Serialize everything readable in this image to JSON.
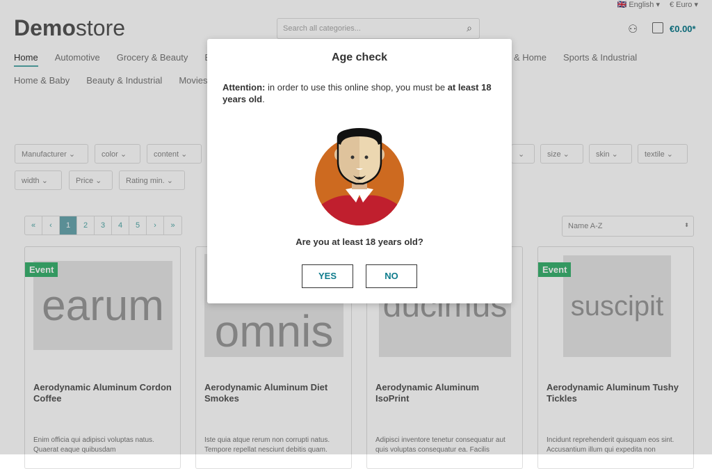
{
  "header": {
    "language": "English",
    "currency": "€ Euro",
    "logo_bold": "Demo",
    "logo_light": "store",
    "search_placeholder": "Search all categories...",
    "cart_total": "€0.00*"
  },
  "nav": {
    "row1": [
      "Home",
      "Automotive",
      "Grocery & Beauty",
      "Be",
      "& Home",
      "Sports & Industrial"
    ],
    "row2": [
      "Home & Baby",
      "Beauty & Industrial",
      "Movies &"
    ]
  },
  "filters": {
    "row1": [
      "Manufacturer",
      "color",
      "content",
      "",
      "size",
      "skin",
      "textile"
    ],
    "row2": [
      "width",
      "Price",
      "Rating min."
    ]
  },
  "pagination": [
    "«",
    "‹",
    "1",
    "2",
    "3",
    "4",
    "5",
    "›",
    "»"
  ],
  "sort": "Name A-Z",
  "products": [
    {
      "image_text": "earum",
      "badge": "Event",
      "title": "Aerodynamic Aluminum Cordon Coffee",
      "desc": "Enim officia qui adipisci voluptas natus. Quaerat eaque quibusdam"
    },
    {
      "image_text": "omnis",
      "badge": "",
      "title": "Aerodynamic Aluminum Diet Smokes",
      "desc": "Iste quia atque rerum non corrupti natus. Tempore repellat nesciunt debitis quam."
    },
    {
      "image_text": "ducimus",
      "badge": "",
      "title": "Aerodynamic Aluminum IsoPrint",
      "desc": "Adipisci inventore tenetur consequatur aut quis voluptas consequatur ea. Facilis"
    },
    {
      "image_text": "suscipit",
      "badge": "Event",
      "title": "Aerodynamic Aluminum Tushy Tickles",
      "desc": "Incidunt reprehenderit quisquam eos sint. Accusantium illum qui expedita non"
    }
  ],
  "modal": {
    "title": "Age check",
    "attention": "Attention:",
    "msg_mid": " in order to use this online shop, you must be ",
    "msg_bold": "at least 18 years old",
    "msg_end": ".",
    "question": "Are you at least 18 years old?",
    "yes": "YES",
    "no": "NO"
  }
}
